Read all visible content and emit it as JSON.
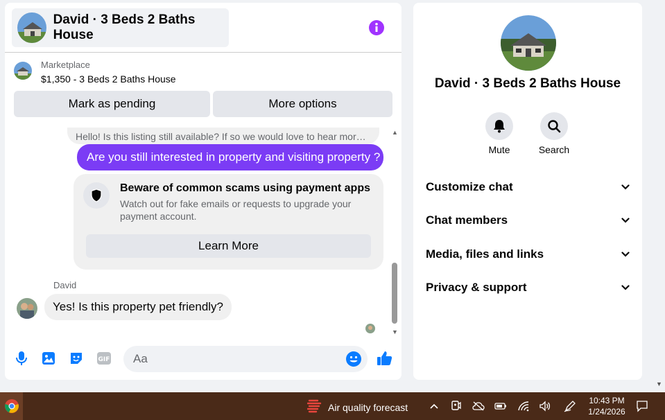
{
  "chat": {
    "header_title": "David · 3 Beds 2 Baths House",
    "listing_category": "Marketplace",
    "listing_title": "$1,350 - 3 Beds 2 Baths House",
    "mark_pending_label": "Mark as pending",
    "more_options_label": "More options",
    "messages": {
      "previous_snippet": "Hello! Is this listing still available? If so we would love to hear more about it",
      "outgoing": "Are you still interested in property and visiting property ?",
      "scam_title": "Beware of common scams using payment apps",
      "scam_body": "Watch out for fake emails or requests to upgrade your payment account.",
      "learn_more_label": "Learn More",
      "sender_name": "David",
      "incoming": "Yes! Is this property pet friendly?"
    },
    "composer_placeholder": "Aa"
  },
  "info": {
    "name": "David · 3 Beds 2 Baths House",
    "actions": [
      "Mute",
      "Search"
    ],
    "sections": [
      "Customize chat",
      "Chat members",
      "Media, files and links",
      "Privacy & support"
    ]
  },
  "taskbar": {
    "weather_text": "Air quality forecast",
    "time": "10:43 PM",
    "date": "1/24/2026"
  },
  "colors": {
    "accent_purple": "#7b3cf5",
    "messenger_blue": "#0a7cff",
    "info_icon": "#a033ff",
    "taskbar_bg": "#4a2a18"
  }
}
